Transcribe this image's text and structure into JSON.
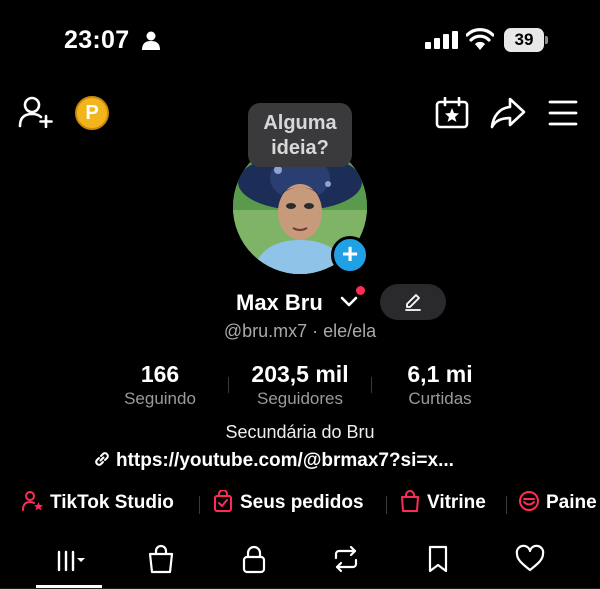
{
  "status_bar": {
    "time": "23:07",
    "battery": "39"
  },
  "header": {
    "tooltip": "Alguma ideia?",
    "coin_label": "P"
  },
  "profile": {
    "name": "Max Bru",
    "handle": "@bru.mx7 · ele/ela",
    "bio": "Secundária do Bru",
    "link": "https://youtube.com/@brmax7?si=x...",
    "add_badge": "+"
  },
  "stats": [
    {
      "value": "166",
      "label": "Seguindo"
    },
    {
      "value": "203,5 mil",
      "label": "Seguidores"
    },
    {
      "value": "6,1 mi",
      "label": "Curtidas"
    }
  ],
  "shortcuts": [
    {
      "label": "TikTok Studio",
      "icon": "person-star-icon"
    },
    {
      "label": "Seus pedidos",
      "icon": "order-bag-icon"
    },
    {
      "label": "Vitrine",
      "icon": "shop-bag-icon"
    },
    {
      "label": "Paine",
      "icon": "panel-icon"
    }
  ],
  "tabs": [
    "videos-grid",
    "shop-bag",
    "lock",
    "repost",
    "bookmark",
    "heart"
  ],
  "colors": {
    "accent": "#fe2c55",
    "badge_blue": "#20a1e6",
    "coin": "#f2b51c",
    "background": "#000000"
  }
}
